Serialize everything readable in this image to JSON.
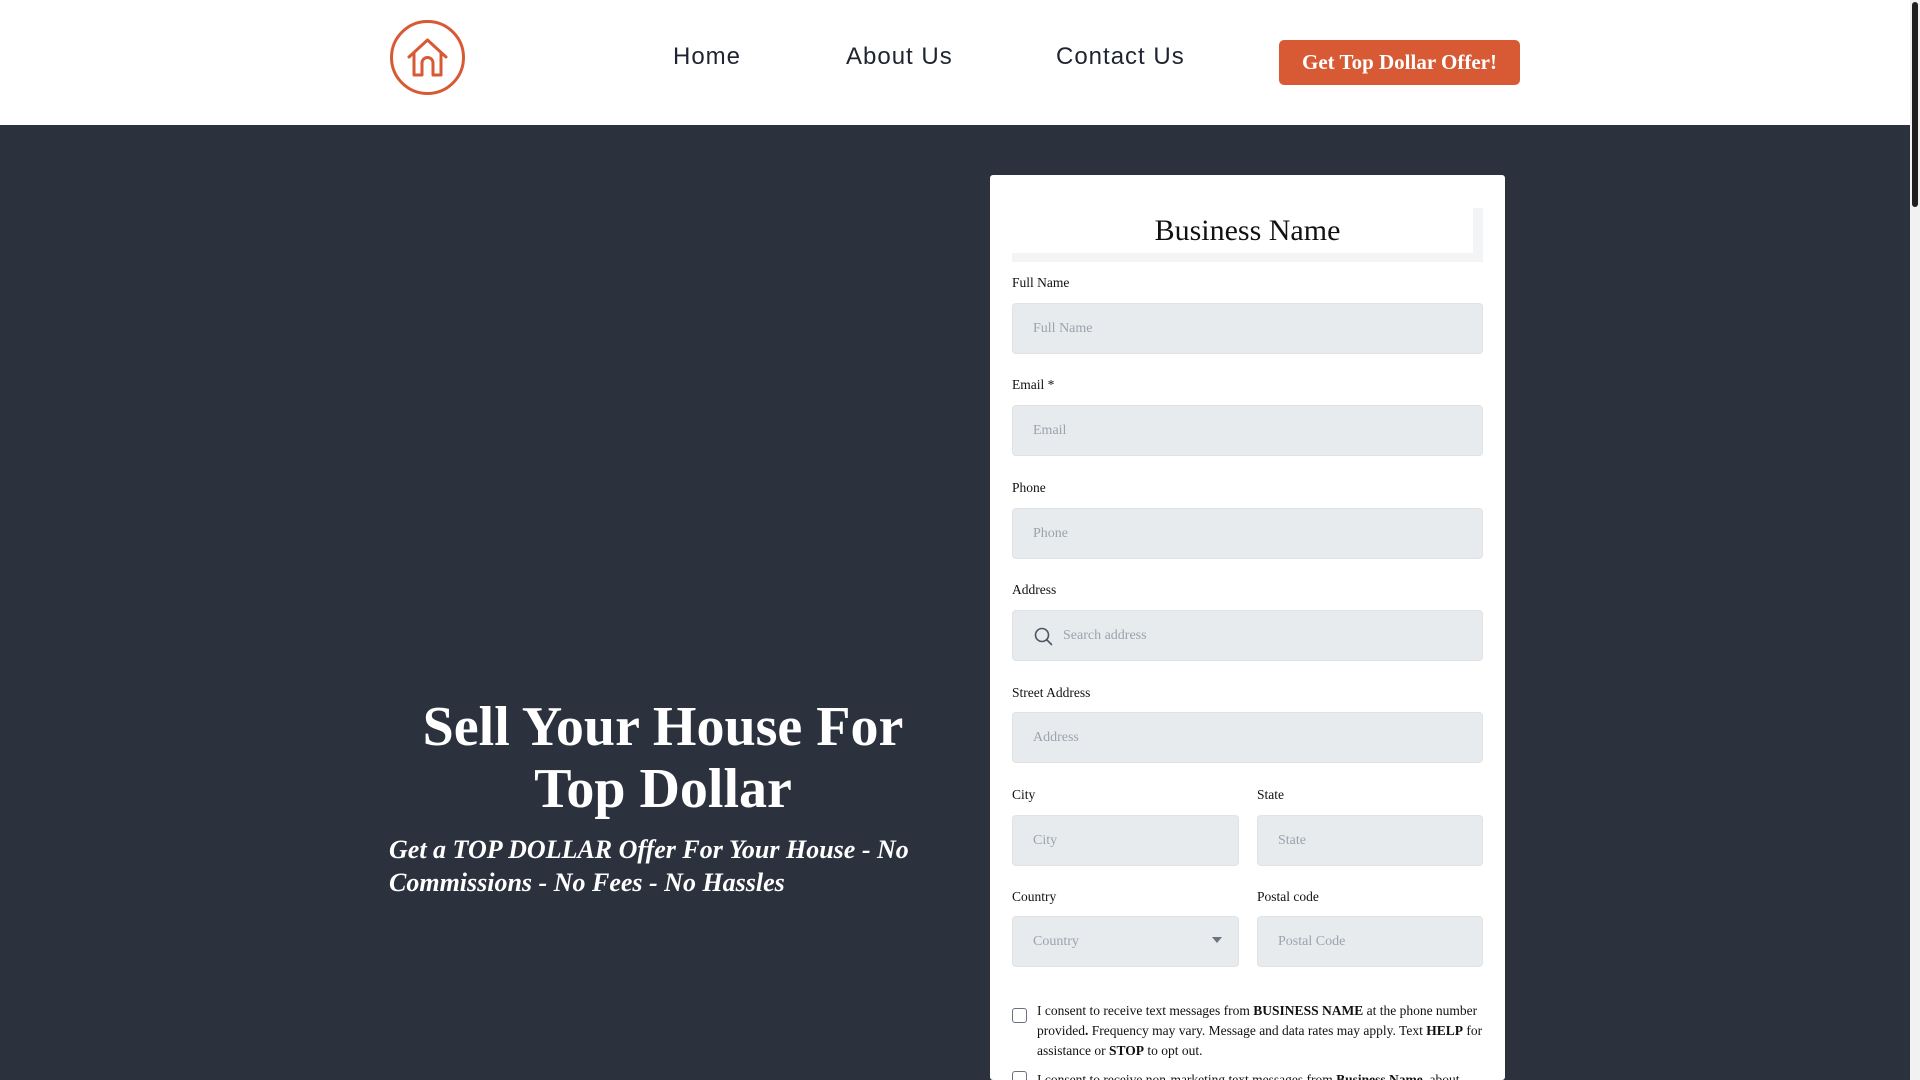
{
  "header": {
    "logo_icon": "house-outline-icon",
    "nav": {
      "home": "Home",
      "about": "About Us",
      "contact": "Contact Us"
    },
    "cta_label": "Get Top Dollar Offer!",
    "brand_color": "#d85a35"
  },
  "hero": {
    "title": "Sell Your House For Top Dollar",
    "subtitle": "Get a TOP DOLLAR Offer For Your House - No Commissions - No Fees - No Hassles",
    "background_color": "#2b323d"
  },
  "form": {
    "business_name": "Business Name",
    "fields": {
      "full_name": {
        "label": "Full Name",
        "placeholder": "Full Name"
      },
      "email": {
        "label": "Email *",
        "placeholder": "Email"
      },
      "phone": {
        "label": "Phone",
        "placeholder": "Phone"
      },
      "address": {
        "label": "Address",
        "placeholder": "Search address",
        "icon": "search-icon"
      },
      "street": {
        "label": "Street Address",
        "placeholder": "Address"
      },
      "city": {
        "label": "City",
        "placeholder": "City"
      },
      "state": {
        "label": "State",
        "placeholder": "State"
      },
      "country": {
        "label": "Country",
        "placeholder": "Country",
        "icon": "chevron-down-icon"
      },
      "postal": {
        "label": "Postal code",
        "placeholder": "Postal Code"
      }
    },
    "consent1": {
      "part1": "I consent to receive text messages from ",
      "brand": "BUSINESS NAME",
      "part2": " at the phone number provided",
      "period": ".",
      "part3": " Frequency may vary. Message and data rates may apply. Text ",
      "help": "HELP",
      "part4": " for assistance or ",
      "stop": "STOP",
      "part5": " to opt out."
    },
    "consent2": {
      "part1": "I consent to receive non-marketing text messages from ",
      "brand": "Business Name",
      "part2": ", about"
    }
  }
}
